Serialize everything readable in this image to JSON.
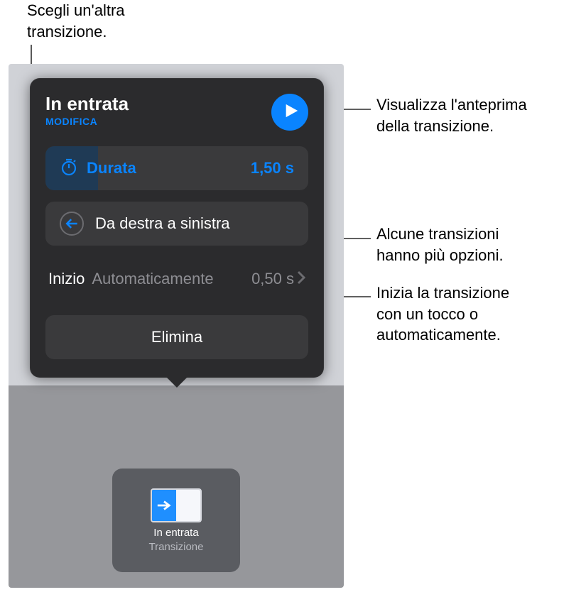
{
  "callouts": {
    "choose": "Scegli un'altra\ntransizione.",
    "preview": "Visualizza l'anteprima\ndella transizione.",
    "options": "Alcune transizioni\nhanno più opzioni.",
    "start": "Inizia la transizione\ncon un tocco o\nautomaticamente."
  },
  "popup": {
    "title": "In entrata",
    "modify": "MODIFICA",
    "duration_label": "Durata",
    "duration_value": "1,50 s",
    "direction_label": "Da destra a sinistra",
    "start_label": "Inizio",
    "start_mode": "Automaticamente",
    "start_delay": "0,50 s",
    "delete_label": "Elimina"
  },
  "thumb": {
    "title": "In entrata",
    "subtitle": "Transizione"
  }
}
